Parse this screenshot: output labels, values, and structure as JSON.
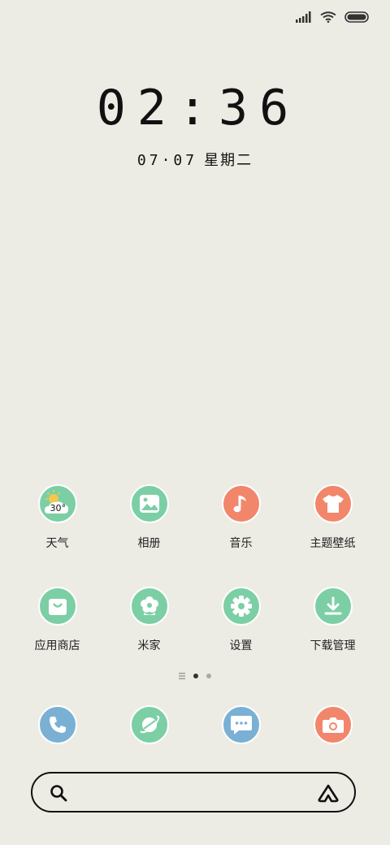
{
  "status_bar": {
    "signal_icon": "signal-icon",
    "wifi_icon": "wifi-icon",
    "battery_icon": "battery-icon"
  },
  "clock": {
    "time": "02:36"
  },
  "date": {
    "day": "07·07",
    "weekday": "星期二"
  },
  "apps_row1": [
    {
      "label": "天气",
      "icon": "weather-icon",
      "color": "#7ccfa5",
      "temp": "30°"
    },
    {
      "label": "相册",
      "icon": "gallery-icon",
      "color": "#7ccfa5"
    },
    {
      "label": "音乐",
      "icon": "music-icon",
      "color": "#f2866b"
    },
    {
      "label": "主题壁纸",
      "icon": "theme-icon",
      "color": "#f2866b"
    }
  ],
  "apps_row2": [
    {
      "label": "应用商店",
      "icon": "store-icon",
      "color": "#7ccfa5"
    },
    {
      "label": "米家",
      "icon": "flower-icon",
      "color": "#7ccfa5"
    },
    {
      "label": "设置",
      "icon": "gear-icon",
      "color": "#7ccfa5"
    },
    {
      "label": "下载管理",
      "icon": "download-icon",
      "color": "#7ccfa5"
    }
  ],
  "page_indicator": {
    "pages": 3,
    "active": 1
  },
  "dock": [
    {
      "icon": "phone-icon",
      "color": "#7ab0d4"
    },
    {
      "icon": "browser-icon",
      "color": "#7ccfa5"
    },
    {
      "icon": "messages-icon",
      "color": "#7ab0d4"
    },
    {
      "icon": "camera-icon",
      "color": "#f2866b"
    }
  ],
  "search_bar": {
    "search_icon": "search-icon",
    "assistant_icon": "assistant-icon"
  }
}
